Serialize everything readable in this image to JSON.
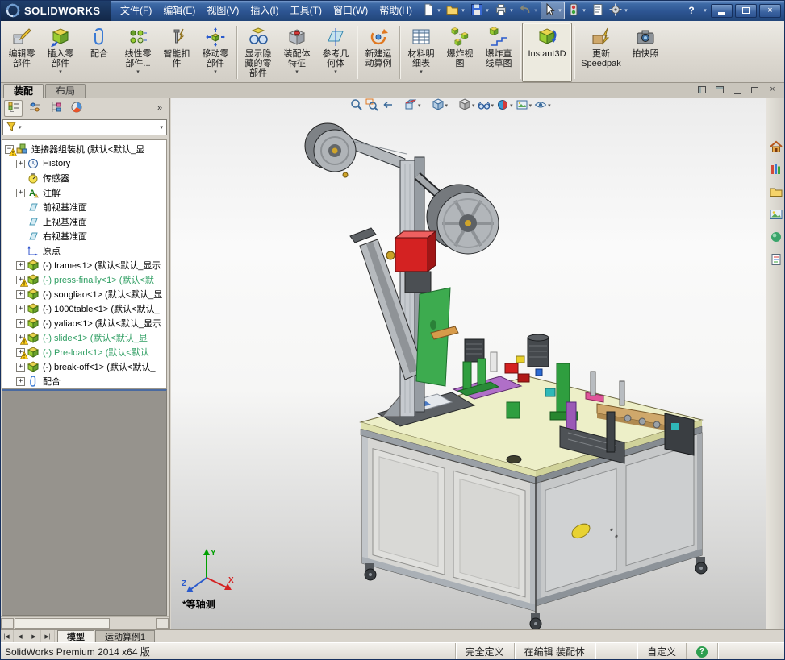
{
  "glyphs": {
    "caret": "▾",
    "chevron": "»",
    "plus": "+",
    "minus": "−",
    "nav_first": "|◀",
    "nav_prev": "◀",
    "nav_next": "▶",
    "nav_last": "▶|",
    "close": "×",
    "help": "?",
    "minimize": "—"
  },
  "titlebar": {
    "logo_text": "SOLIDWORKS",
    "menus": [
      "文件(F)",
      "编辑(E)",
      "视图(V)",
      "插入(I)",
      "工具(T)",
      "窗口(W)",
      "帮助(H)"
    ],
    "tools": [
      {
        "icon": "new-document-icon",
        "caret": true
      },
      {
        "icon": "open-document-icon",
        "caret": true
      },
      {
        "icon": "save-icon",
        "caret": true
      },
      {
        "icon": "print-icon",
        "caret": true
      },
      {
        "icon": "undo-icon",
        "caret": true,
        "disabled": true
      },
      {
        "icon": "select-icon",
        "caret": true,
        "pressed": true
      },
      {
        "icon": "rebuild-icon",
        "caret": true
      },
      {
        "icon": "file-properties-icon"
      },
      {
        "icon": "options-icon",
        "caret": true
      }
    ]
  },
  "ribbon": {
    "buttons": [
      {
        "label": "编辑零\n部件",
        "icon": "edit-component-icon"
      },
      {
        "label": "插入零\n部件",
        "icon": "insert-component-icon",
        "caret": true
      },
      {
        "label": "配合",
        "icon": "mate-icon"
      },
      {
        "label": "线性零\n部件...",
        "icon": "linear-pattern-icon",
        "caret": true
      },
      {
        "label": "智能扣\n件",
        "icon": "smart-fastener-icon"
      },
      {
        "label": "移动零\n部件",
        "icon": "move-component-icon",
        "caret": true
      },
      {
        "label": "显示隐\n藏的零\n部件",
        "icon": "show-hidden-icon",
        "sep": true
      },
      {
        "label": "装配体\n特征",
        "icon": "assembly-features-icon",
        "caret": true
      },
      {
        "label": "参考几\n何体",
        "icon": "reference-geometry-icon",
        "caret": true
      },
      {
        "label": "新建运\n动算例",
        "icon": "motion-study-icon",
        "sep": true
      },
      {
        "label": "材料明\n细表",
        "icon": "bom-icon",
        "caret": true,
        "sep": true
      },
      {
        "label": "爆炸视\n图",
        "icon": "exploded-view-icon"
      },
      {
        "label": "爆炸直\n线草图",
        "icon": "explode-sketch-icon"
      },
      {
        "label": "Instant3D",
        "icon": "instant3d-icon",
        "active": true,
        "wide": true,
        "sep": true
      },
      {
        "label": "更新\nSpeedpak",
        "icon": "speedpak-icon",
        "wide": true,
        "sep": true
      },
      {
        "label": "拍快照",
        "icon": "snapshot-icon"
      }
    ]
  },
  "tabs": {
    "items": [
      "装配",
      "布局"
    ],
    "active": 0
  },
  "tree": {
    "root": {
      "label": "连接器组装机 (默认<默认_显",
      "icon": "assembly-icon",
      "warn": true
    },
    "items": [
      {
        "label": "History",
        "icon": "history-folder-icon",
        "plus": true
      },
      {
        "label": "传感器",
        "icon": "sensors-folder-icon",
        "plus": false
      },
      {
        "label": "注解",
        "icon": "annotations-icon",
        "plus": true
      },
      {
        "label": "前视基准面",
        "icon": "plane-icon",
        "plus": false
      },
      {
        "label": "上视基准面",
        "icon": "plane-icon",
        "plus": false
      },
      {
        "label": "右视基准面",
        "icon": "plane-icon",
        "plus": false
      },
      {
        "label": "原点",
        "icon": "origin-icon",
        "plus": false
      },
      {
        "label": "(-) frame<1> (默认<默认_显示",
        "icon": "part-icon",
        "plus": true
      },
      {
        "label": "(-) press-finally<1> (默认<默",
        "icon": "part-icon",
        "plus": true,
        "warn": true,
        "green": true
      },
      {
        "label": "(-) songliao<1> (默认<默认_显",
        "icon": "part-icon",
        "plus": true
      },
      {
        "label": "(-) 1000table<1> (默认<默认_",
        "icon": "part-icon",
        "plus": true
      },
      {
        "label": "(-) yaliao<1> (默认<默认_显示",
        "icon": "part-icon",
        "plus": true
      },
      {
        "label": "(-) slide<1> (默认<默认_显",
        "icon": "part-icon",
        "plus": true,
        "warn": true,
        "green": true
      },
      {
        "label": "(-) Pre-load<1> (默认<默认",
        "icon": "part-icon",
        "plus": true,
        "warn": true,
        "green": true
      },
      {
        "label": "(-) break-off<1> (默认<默认_",
        "icon": "part-icon",
        "plus": true
      },
      {
        "label": "配合",
        "icon": "mates-icon",
        "plus": true
      }
    ]
  },
  "hud": [
    {
      "icon": "zoom-fit-icon"
    },
    {
      "icon": "zoom-area-icon"
    },
    {
      "icon": "previous-view-icon"
    },
    {
      "icon": "section-view-icon",
      "caret": true,
      "gap": true
    },
    {
      "icon": "view-orientation-icon",
      "caret": true,
      "gap": true
    },
    {
      "icon": "display-style-icon",
      "caret": true,
      "gap": true
    },
    {
      "icon": "hide-show-items-icon",
      "caret": true
    },
    {
      "icon": "edit-appearance-icon",
      "caret": true
    },
    {
      "icon": "apply-scene-icon",
      "caret": true
    },
    {
      "icon": "view-settings-icon",
      "caret": true
    }
  ],
  "taskpane": [
    {
      "icon": "resources-home-icon"
    },
    {
      "icon": "design-library-icon"
    },
    {
      "icon": "file-explorer-icon"
    },
    {
      "icon": "view-palette-icon"
    },
    {
      "icon": "appearances-icon"
    },
    {
      "icon": "custom-properties-icon"
    }
  ],
  "viewport": {
    "view_label": "*等轴测",
    "axis_x": "X",
    "axis_y": "Y",
    "axis_z": "Z"
  },
  "bottom": {
    "tabs": [
      {
        "label": "模型",
        "active": true
      },
      {
        "label": "运动算例1",
        "active": false
      }
    ]
  },
  "statusbar": {
    "app": "SolidWorks Premium 2014 x64 版",
    "define_state": "完全定义",
    "edit_state": "在编辑 装配体",
    "custom": "自定义"
  }
}
